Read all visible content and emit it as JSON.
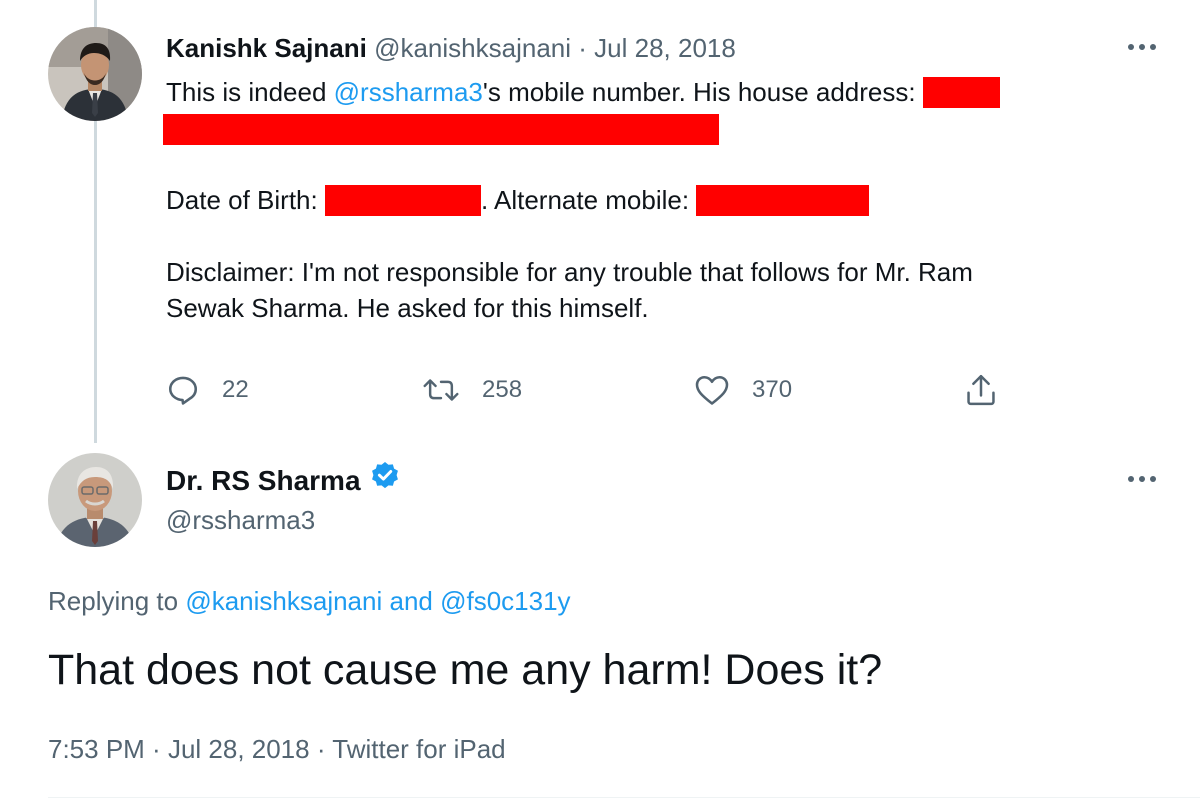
{
  "tweet1": {
    "author_name": "Kanishk Sajnani",
    "handle": "@kanishksajnani",
    "separator": "·",
    "date": "Jul 28, 2018",
    "body": {
      "line1_prefix": "This is indeed ",
      "line1_mention": "@rssharma3",
      "line1_suffix": "'s mobile number. His house address: ",
      "dob_label": "Date of Birth: ",
      "alt_mobile_label": ". Alternate mobile: ",
      "disclaimer_line1": "Disclaimer: I'm not responsible for any trouble that follows for Mr. Ram",
      "disclaimer_line2": "Sewak Sharma. He asked for this himself."
    },
    "redaction_color": "#ff0000",
    "stats": {
      "replies": "22",
      "retweets": "258",
      "likes": "370"
    },
    "icons": [
      "reply-icon",
      "retweet-icon",
      "like-icon",
      "share-icon",
      "more-options-icon"
    ]
  },
  "tweet2": {
    "author_name": "Dr. RS Sharma",
    "verified": true,
    "handle": "@rssharma3",
    "replying_prefix": "Replying to ",
    "replying_to_1": "@kanishksajnani",
    "replying_and": " and ",
    "replying_to_2": "@fs0c131y",
    "text": "That does not cause me any harm! Does it?",
    "time": "7:53 PM",
    "separator": " · ",
    "date": "Jul 28, 2018",
    "source": "Twitter for iPad",
    "icons": [
      "verified-badge-icon",
      "more-options-icon"
    ]
  },
  "colors": {
    "link": "#1d9bf0",
    "text": "#0f1419",
    "muted": "#536471",
    "thread_line": "#cfd9de"
  }
}
